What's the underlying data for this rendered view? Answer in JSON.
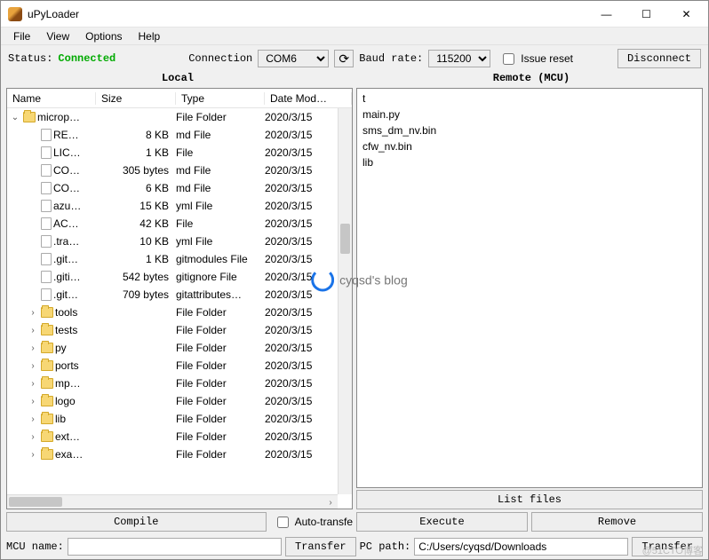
{
  "window": {
    "title": "uPyLoader"
  },
  "menu": {
    "file": "File",
    "view": "View",
    "options": "Options",
    "help": "Help"
  },
  "conn": {
    "status_label": "Status:",
    "status_value": "Connected",
    "connection_label": "Connection",
    "port": "COM6",
    "refresh_icon": "⟳",
    "baud_label": "Baud rate:",
    "baud": "115200",
    "issue_reset": "Issue reset",
    "disconnect": "Disconnect"
  },
  "panes": {
    "local": "Local",
    "remote": "Remote (MCU)"
  },
  "local": {
    "columns": {
      "name": "Name",
      "size": "Size",
      "type": "Type",
      "date": "Date Mod…"
    },
    "rows": [
      {
        "exp": "⌄",
        "depth": 0,
        "icon": "folder",
        "name": "microp…",
        "size": "",
        "type": "File Folder",
        "date": "2020/3/15"
      },
      {
        "exp": "",
        "depth": 1,
        "icon": "file",
        "name": "RE…",
        "size": "8 KB",
        "type": "md File",
        "date": "2020/3/15"
      },
      {
        "exp": "",
        "depth": 1,
        "icon": "file",
        "name": "LIC…",
        "size": "1 KB",
        "type": "File",
        "date": "2020/3/15"
      },
      {
        "exp": "",
        "depth": 1,
        "icon": "file",
        "name": "CO…",
        "size": "305 bytes",
        "type": "md File",
        "date": "2020/3/15"
      },
      {
        "exp": "",
        "depth": 1,
        "icon": "file",
        "name": "CO…",
        "size": "6 KB",
        "type": "md File",
        "date": "2020/3/15"
      },
      {
        "exp": "",
        "depth": 1,
        "icon": "file",
        "name": "azu…",
        "size": "15 KB",
        "type": "yml File",
        "date": "2020/3/15"
      },
      {
        "exp": "",
        "depth": 1,
        "icon": "file",
        "name": "AC…",
        "size": "42 KB",
        "type": "File",
        "date": "2020/3/15"
      },
      {
        "exp": "",
        "depth": 1,
        "icon": "file",
        "name": ".tra…",
        "size": "10 KB",
        "type": "yml File",
        "date": "2020/3/15"
      },
      {
        "exp": "",
        "depth": 1,
        "icon": "file",
        "name": ".git…",
        "size": "1 KB",
        "type": "gitmodules File",
        "date": "2020/3/15"
      },
      {
        "exp": "",
        "depth": 1,
        "icon": "file",
        "name": ".giti…",
        "size": "542 bytes",
        "type": "gitignore File",
        "date": "2020/3/15"
      },
      {
        "exp": "",
        "depth": 1,
        "icon": "file",
        "name": ".git…",
        "size": "709 bytes",
        "type": "gitattributes…",
        "date": "2020/3/15"
      },
      {
        "exp": "›",
        "depth": 1,
        "icon": "folder",
        "name": "tools",
        "size": "",
        "type": "File Folder",
        "date": "2020/3/15"
      },
      {
        "exp": "›",
        "depth": 1,
        "icon": "folder",
        "name": "tests",
        "size": "",
        "type": "File Folder",
        "date": "2020/3/15"
      },
      {
        "exp": "›",
        "depth": 1,
        "icon": "folder",
        "name": "py",
        "size": "",
        "type": "File Folder",
        "date": "2020/3/15"
      },
      {
        "exp": "›",
        "depth": 1,
        "icon": "folder",
        "name": "ports",
        "size": "",
        "type": "File Folder",
        "date": "2020/3/15"
      },
      {
        "exp": "›",
        "depth": 1,
        "icon": "folder",
        "name": "mp…",
        "size": "",
        "type": "File Folder",
        "date": "2020/3/15"
      },
      {
        "exp": "›",
        "depth": 1,
        "icon": "folder",
        "name": "logo",
        "size": "",
        "type": "File Folder",
        "date": "2020/3/15"
      },
      {
        "exp": "›",
        "depth": 1,
        "icon": "folder",
        "name": "lib",
        "size": "",
        "type": "File Folder",
        "date": "2020/3/15"
      },
      {
        "exp": "›",
        "depth": 1,
        "icon": "folder",
        "name": "ext…",
        "size": "",
        "type": "File Folder",
        "date": "2020/3/15"
      },
      {
        "exp": "›",
        "depth": 1,
        "icon": "folder",
        "name": "exa…",
        "size": "",
        "type": "File Folder",
        "date": "2020/3/15"
      }
    ]
  },
  "remote": {
    "items": [
      "t",
      "main.py",
      "sms_dm_nv.bin",
      "cfw_nv.bin",
      "lib"
    ],
    "list_files": "List files"
  },
  "bottom1": {
    "compile": "Compile",
    "auto_transfer": "Auto-transfe",
    "execute": "Execute",
    "remove": "Remove"
  },
  "bottom2": {
    "mcu_name_label": "MCU name:",
    "mcu_name_value": "",
    "transfer_left": "Transfer",
    "pc_path_label": "PC path:",
    "pc_path_value": "C:/Users/cyqsd/Downloads",
    "transfer_right": "Transfer"
  },
  "overlay": {
    "blog": "cyqsd's blog"
  },
  "watermark": "@51CTO博客"
}
